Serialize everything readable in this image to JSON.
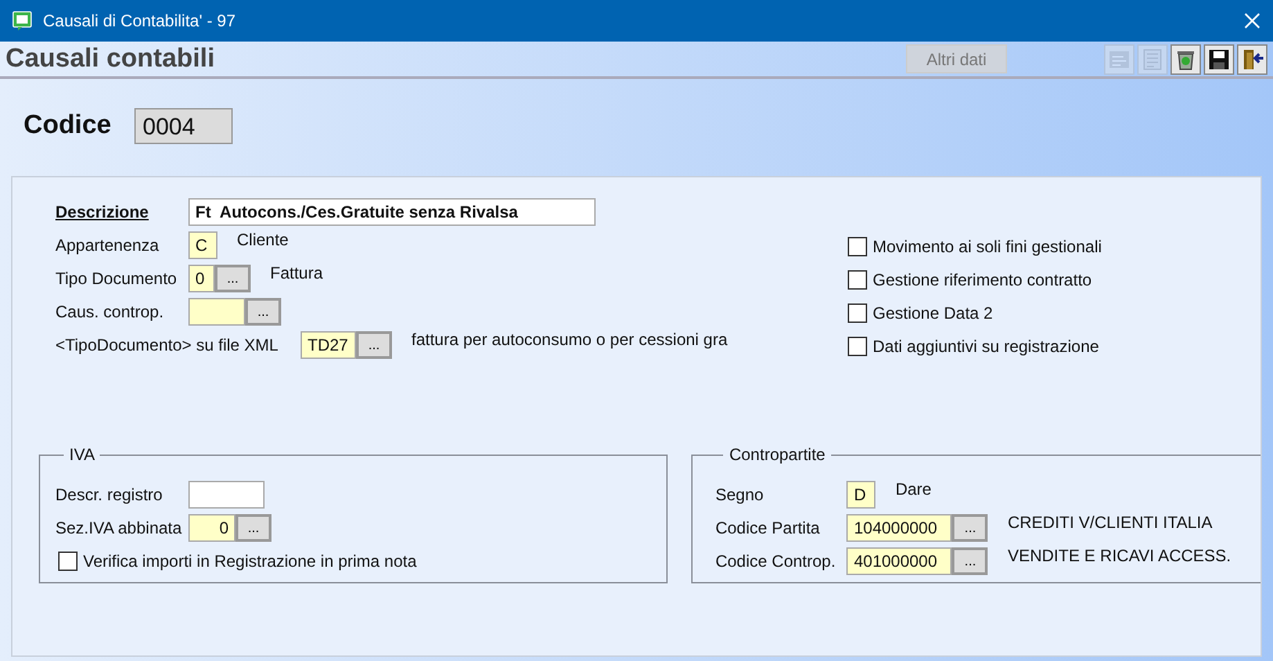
{
  "window": {
    "title": "Causali di Contabilita' - 97"
  },
  "header": {
    "title": "Causali contabili",
    "altri_dati": {
      "label": "Altri dati",
      "disabled": true
    },
    "toolbar": [
      {
        "kind": "print",
        "disabled": true
      },
      {
        "kind": "list",
        "disabled": true
      },
      {
        "kind": "recycle",
        "disabled": false
      },
      {
        "kind": "save",
        "disabled": false
      },
      {
        "kind": "exit",
        "disabled": false
      }
    ]
  },
  "codice": {
    "label": "Codice",
    "value": "0004"
  },
  "general": {
    "fields": [
      {
        "label": "Descrizione",
        "kind": "description",
        "value": "Ft  Autocons./Ces.Gratuite senza Rivalsa"
      },
      {
        "label": "Appartenenza",
        "kind": "letter",
        "value": "C",
        "note": "Cliente"
      },
      {
        "label": "Tipo Documento",
        "kind": "digit",
        "value": "0",
        "button": "...",
        "note": "Fattura"
      },
      {
        "label": "Caus. controp.",
        "kind": "blank",
        "button": "..."
      },
      {
        "label": "<TipoDocumento> su file XML",
        "kind": "code",
        "value": "TD27",
        "button": "...",
        "note": "fattura per autoconsumo o per cessioni gra"
      }
    ],
    "options": [
      {
        "label": "Movimento ai soli fini gestionali",
        "checked": false
      },
      {
        "label": "Gestione riferimento contratto",
        "checked": false
      },
      {
        "label": "Gestione Data 2",
        "checked": false
      },
      {
        "label": "Dati aggiuntivi su registrazione",
        "checked": false
      }
    ]
  },
  "iva": {
    "title": "IVA",
    "fields": [
      {
        "label": "Descr. registro",
        "kind": "plain"
      },
      {
        "label": "Sez.IVA abbinata",
        "kind": "number",
        "value": "0",
        "button": "..."
      }
    ],
    "option": {
      "label": "Verifica importi in Registrazione in prima nota",
      "checked": false
    }
  },
  "contropartite": {
    "title": "Contropartite",
    "fields": [
      {
        "label": "Segno",
        "kind": "letter",
        "value": "D",
        "note": "Dare"
      },
      {
        "label": "Codice Partita",
        "kind": "account",
        "value": "104000000",
        "button": "...",
        "note": "CREDITI V/CLIENTI ITALIA"
      },
      {
        "label": "Codice Controp.",
        "kind": "account",
        "value": "401000000",
        "button": "...",
        "note": "VENDITE E RICAVI ACCESS."
      }
    ]
  }
}
